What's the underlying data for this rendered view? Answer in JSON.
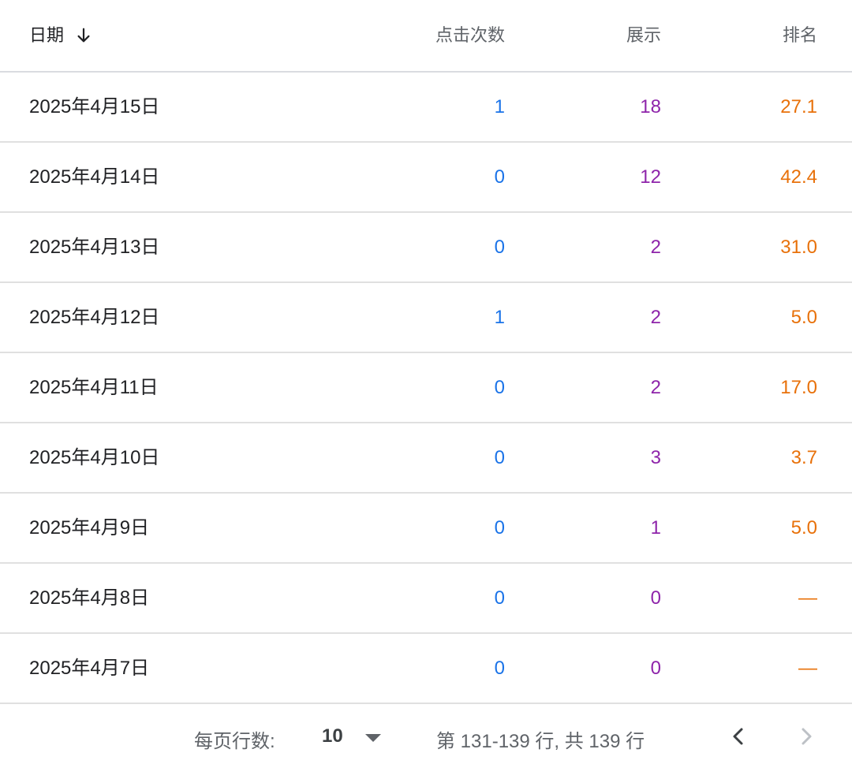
{
  "header": {
    "date": "日期",
    "clicks": "点击次数",
    "impressions": "展示",
    "position": "排名"
  },
  "rows": [
    {
      "date": "2025年4月15日",
      "clicks": "1",
      "impressions": "18",
      "position": "27.1"
    },
    {
      "date": "2025年4月14日",
      "clicks": "0",
      "impressions": "12",
      "position": "42.4"
    },
    {
      "date": "2025年4月13日",
      "clicks": "0",
      "impressions": "2",
      "position": "31.0"
    },
    {
      "date": "2025年4月12日",
      "clicks": "1",
      "impressions": "2",
      "position": "5.0"
    },
    {
      "date": "2025年4月11日",
      "clicks": "0",
      "impressions": "2",
      "position": "17.0"
    },
    {
      "date": "2025年4月10日",
      "clicks": "0",
      "impressions": "3",
      "position": "3.7"
    },
    {
      "date": "2025年4月9日",
      "clicks": "0",
      "impressions": "1",
      "position": "5.0"
    },
    {
      "date": "2025年4月8日",
      "clicks": "0",
      "impressions": "0",
      "position": "—"
    },
    {
      "date": "2025年4月7日",
      "clicks": "0",
      "impressions": "0",
      "position": "—"
    }
  ],
  "footer": {
    "rows_per_page_label": "每页行数:",
    "rows_per_page_value": "10",
    "range_text": "第 131-139 行, 共 139 行"
  },
  "icons": {
    "sort": "arrow-down-icon",
    "dropdown": "triangle-down-icon",
    "prev": "chevron-left-icon",
    "next": "chevron-right-icon"
  },
  "colors": {
    "clicks": "#1a73e8",
    "impressions": "#8e24aa",
    "position": "#e8710a",
    "divider": "#e0e0e0"
  }
}
